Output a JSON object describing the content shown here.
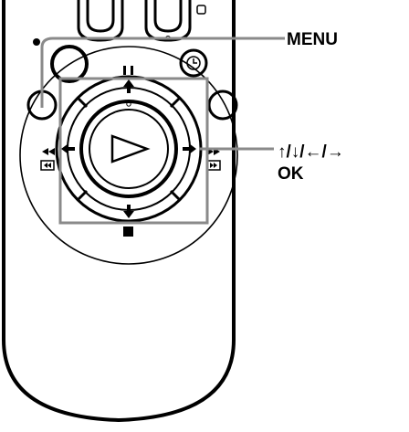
{
  "labels": {
    "menu": "MENU",
    "arrows": "↑/↓/←/→",
    "ok": "OK"
  },
  "remote_symbols": {
    "pause": "II",
    "stop": "■",
    "rewind": "◀◀",
    "fast_forward": "▶▶",
    "play": "▷",
    "timer": "◷"
  },
  "colors": {
    "outline": "#000000",
    "callout_frame": "#8a8a8a",
    "background": "#ffffff"
  }
}
